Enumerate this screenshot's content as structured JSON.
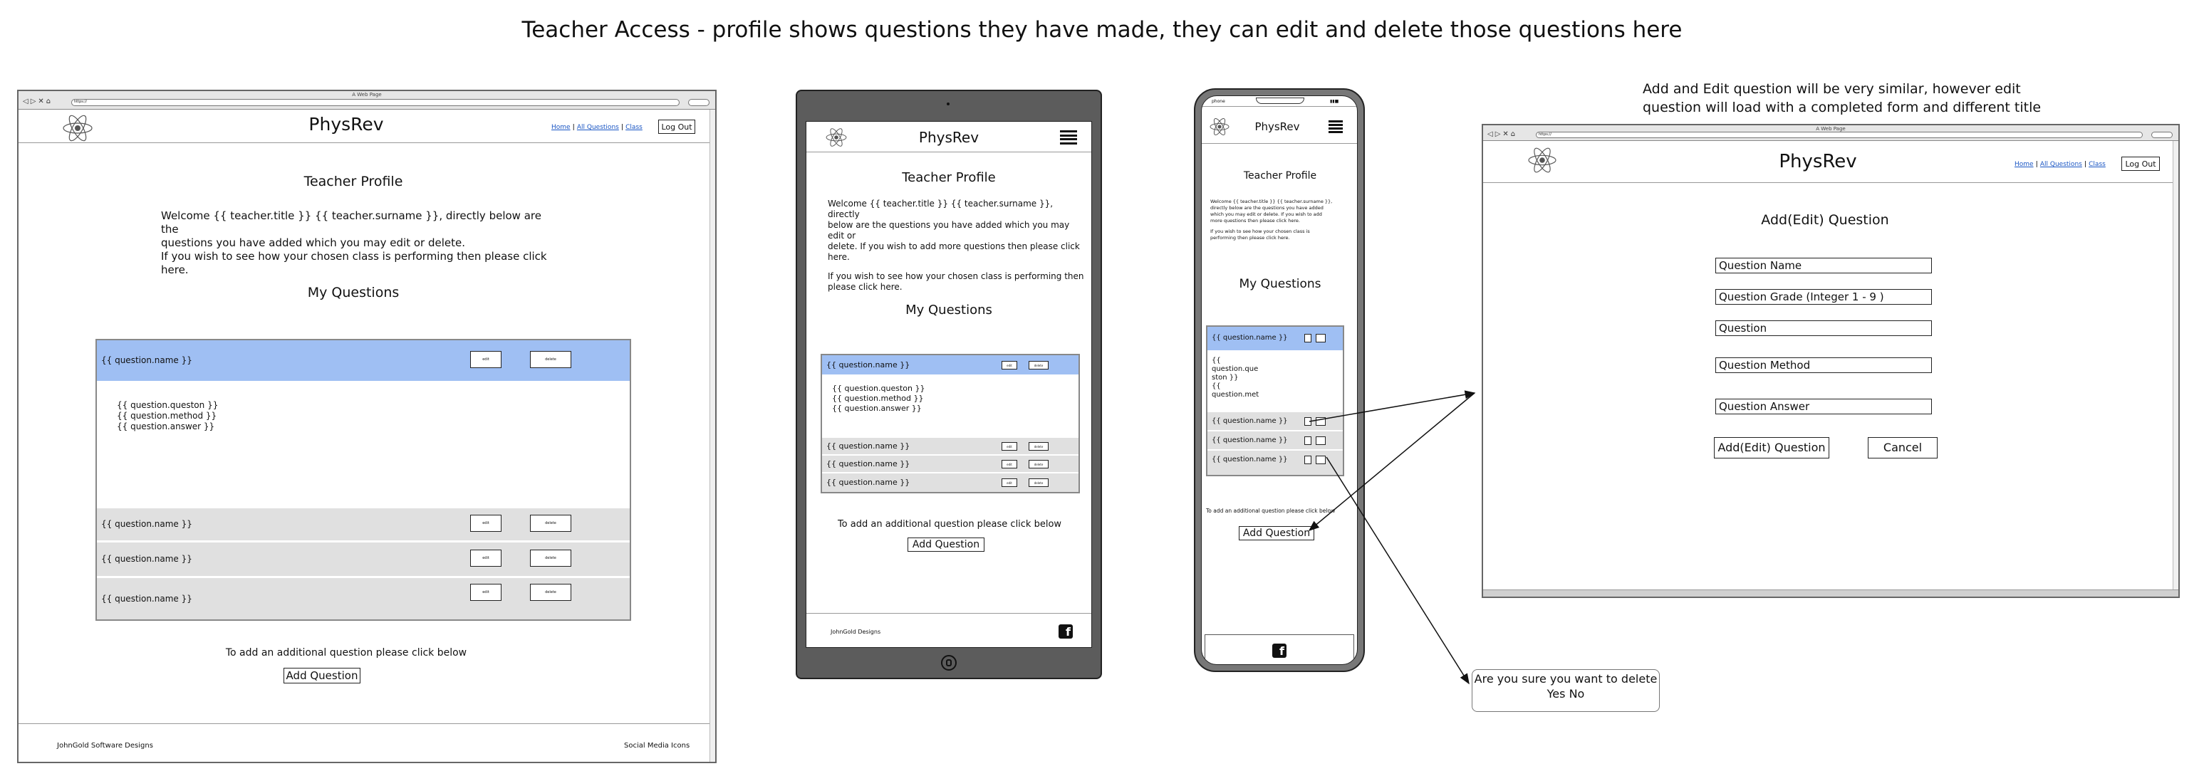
{
  "title": "Teacher Access - profile shows questions they have made, they can edit and delete those questions here",
  "notes": {
    "edit_line1": "Add and Edit question will be very similar, however edit",
    "edit_line2": "question will load with a completed form and different title"
  },
  "brand": "PhysRev",
  "nav": {
    "home": "Home",
    "all_questions": "All Questions",
    "class": "Class",
    "logout": "Log Out"
  },
  "browser": {
    "window_title": "A Web Page",
    "url": "https://"
  },
  "desktop": {
    "heading": "Teacher Profile",
    "welcome_1": "Welcome {{ teacher.title }} {{ teacher.surname }}, directly below are the",
    "welcome_2": "questions you have added which you may edit or delete.",
    "welcome_3": "If you wish to see how your chosen class is performing then please click",
    "welcome_4": "here.",
    "my_questions": "My Questions",
    "rows": [
      {
        "name": "{{ question.name }}",
        "edit": "edit",
        "delete": "delete"
      },
      {
        "name": "{{ question.name }}",
        "edit": "edit",
        "delete": "delete"
      },
      {
        "name": "{{ question.name }}",
        "edit": "edit",
        "delete": "delete"
      },
      {
        "name": "{{ question.name }}",
        "edit": "edit",
        "delete": "delete"
      }
    ],
    "detail": [
      "{{ question.queston }}",
      "{{ question.method }}",
      "{{ question.answer }}"
    ],
    "add_prompt": "To add an additional question please click below",
    "add_button": "Add Question",
    "footer_left": "JohnGold Software Designs",
    "footer_right": "Social Media Icons"
  },
  "tablet": {
    "heading": "Teacher Profile",
    "welcome_1": "Welcome {{ teacher.title }} {{ teacher.surname }}, directly",
    "welcome_2": "below are the questions you have added which you may edit or",
    "welcome_3": "delete. If you wish to add more questions then please click",
    "welcome_4": "here.",
    "class_1": "If you wish to see how your chosen class is performing then",
    "class_2": "please click here.",
    "my_questions": "My Questions",
    "rows": [
      {
        "name": "{{ question.name }}",
        "edit": "edit",
        "delete": "delete"
      },
      {
        "name": "{{ question.name }}",
        "edit": "edit",
        "delete": "delete"
      },
      {
        "name": "{{ question.name }}",
        "edit": "edit",
        "delete": "delete"
      },
      {
        "name": "{{ question.name }}",
        "edit": "edit",
        "delete": "delete"
      }
    ],
    "detail": [
      "{{ question.queston }}",
      "{{ question.method }}",
      "{{ question.answer }}"
    ],
    "add_prompt": "To add an additional question please click below",
    "add_button": "Add Question",
    "footer": "JohnGold Designs"
  },
  "phone": {
    "status_left": "phone",
    "heading": "Teacher Profile",
    "welcome": [
      "Welcome {{ teacher.title }} {{ teacher.surname }},",
      "directly below are the questions you have added",
      "which you may edit or delete. If you wish to add",
      "more questions then please click here.",
      "",
      "If you wish to see how your chosen class is",
      "performing then please click here."
    ],
    "my_questions": "My Questions",
    "rows": [
      {
        "name": "{{ question.name }}"
      },
      {
        "name": "{{ question.name }}"
      },
      {
        "name": "{{ question.name }}"
      },
      {
        "name": "{{ question.name }}"
      }
    ],
    "detail": [
      "{{",
      "question.que",
      "ston }}",
      "{{",
      "question.met"
    ],
    "add_prompt": "To add an additional question please click below",
    "add_button": "Add Question"
  },
  "form": {
    "heading": "Add(Edit) Question",
    "fields": [
      "Question Name",
      "Question Grade (Integer 1 - 9 )",
      "Question",
      "Question Method",
      "Question Answer"
    ],
    "submit": "Add(Edit) Question",
    "cancel": "Cancel"
  },
  "confirm": {
    "line1": "Are you sure you want to delete",
    "line2": "Yes No"
  }
}
